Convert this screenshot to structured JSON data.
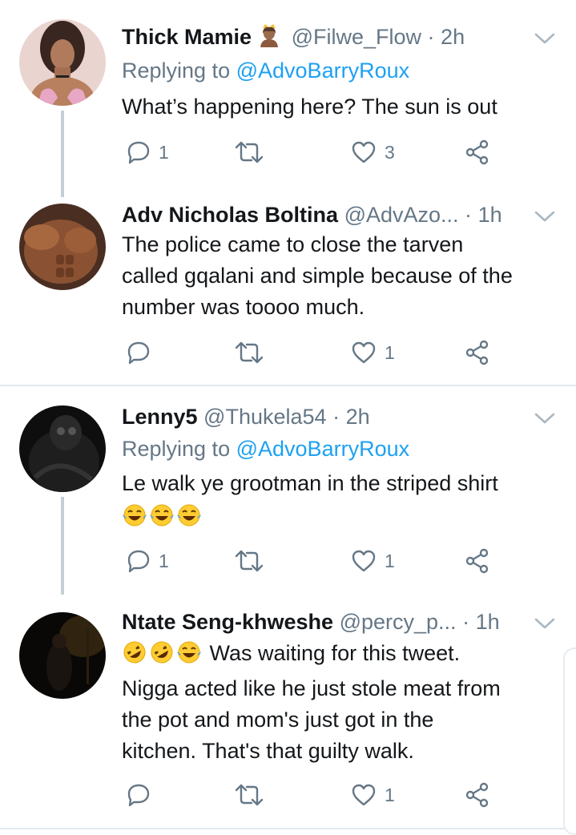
{
  "colors": {
    "text": "#14171a",
    "muted": "#657786",
    "link": "#1da1f2",
    "divider": "#e1e8ed",
    "thread": "#c4cfd6"
  },
  "tweets": [
    {
      "name": "Thick Mamie",
      "badge_icon": "princess-emoji-icon",
      "handle": "@Filwe_Flow",
      "dot": "·",
      "time": "2h",
      "replying_prefix": "Replying to",
      "replying_to": "@AdvoBarryRoux",
      "text": "What’s happening here? The sun is out",
      "reply_count": "1",
      "retweet_count": "",
      "like_count": "3"
    },
    {
      "name": "Adv Nicholas Boltina",
      "handle": "@AdvAzo...",
      "dot": "·",
      "time": "1h",
      "text_lines": [
        "The police came to close the tarven",
        "called gqalani and simple because of the",
        "number was toooo much."
      ],
      "reply_count": "",
      "retweet_count": "",
      "like_count": "1"
    },
    {
      "name": "Lenny5",
      "handle": "@Thukela54",
      "dot": "·",
      "time": "2h",
      "replying_prefix": "Replying to",
      "replying_to": "@AdvoBarryRoux",
      "text": "Le walk ye grootman in the striped shirt",
      "emojis": [
        "tears-of-joy-emoji-icon",
        "tears-of-joy-emoji-icon",
        "tears-of-joy-emoji-icon"
      ],
      "reply_count": "1",
      "retweet_count": "",
      "like_count": "1"
    },
    {
      "name": "Ntate Seng-khweshe",
      "handle": "@percy_p...",
      "dot": "·",
      "time": "1h",
      "emojis": [
        "rofl-emoji-icon",
        "rofl-emoji-icon",
        "tears-of-joy-emoji-icon"
      ],
      "first_line": "Was waiting for this tweet.",
      "text_lines": [
        "Nigga acted like he just stole meat from",
        "the pot and mom's just got in the",
        "kitchen. That's that guilty walk."
      ],
      "reply_count": "",
      "retweet_count": "",
      "like_count": "1"
    }
  ]
}
